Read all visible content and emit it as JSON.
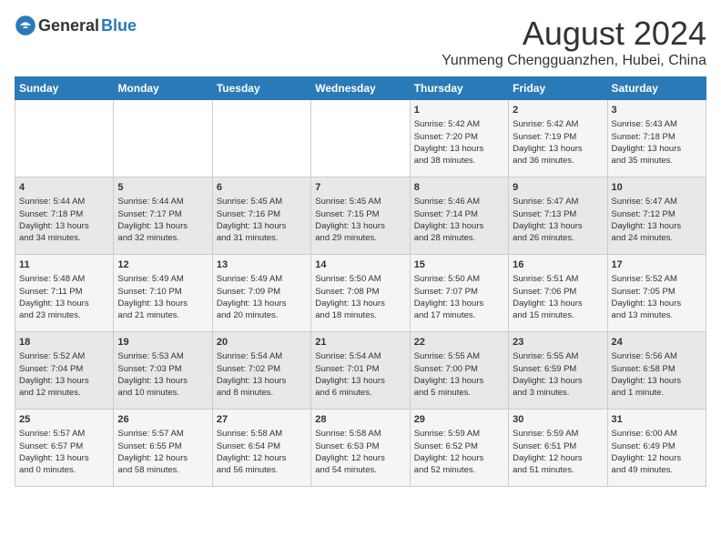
{
  "logo": {
    "general": "General",
    "blue": "Blue"
  },
  "title": "August 2024",
  "location": "Yunmeng Chengguanzhen, Hubei, China",
  "days_of_week": [
    "Sunday",
    "Monday",
    "Tuesday",
    "Wednesday",
    "Thursday",
    "Friday",
    "Saturday"
  ],
  "weeks": [
    [
      {
        "day": "",
        "data": ""
      },
      {
        "day": "",
        "data": ""
      },
      {
        "day": "",
        "data": ""
      },
      {
        "day": "",
        "data": ""
      },
      {
        "day": "1",
        "data": "Sunrise: 5:42 AM\nSunset: 7:20 PM\nDaylight: 13 hours\nand 38 minutes."
      },
      {
        "day": "2",
        "data": "Sunrise: 5:42 AM\nSunset: 7:19 PM\nDaylight: 13 hours\nand 36 minutes."
      },
      {
        "day": "3",
        "data": "Sunrise: 5:43 AM\nSunset: 7:18 PM\nDaylight: 13 hours\nand 35 minutes."
      }
    ],
    [
      {
        "day": "4",
        "data": "Sunrise: 5:44 AM\nSunset: 7:18 PM\nDaylight: 13 hours\nand 34 minutes."
      },
      {
        "day": "5",
        "data": "Sunrise: 5:44 AM\nSunset: 7:17 PM\nDaylight: 13 hours\nand 32 minutes."
      },
      {
        "day": "6",
        "data": "Sunrise: 5:45 AM\nSunset: 7:16 PM\nDaylight: 13 hours\nand 31 minutes."
      },
      {
        "day": "7",
        "data": "Sunrise: 5:45 AM\nSunset: 7:15 PM\nDaylight: 13 hours\nand 29 minutes."
      },
      {
        "day": "8",
        "data": "Sunrise: 5:46 AM\nSunset: 7:14 PM\nDaylight: 13 hours\nand 28 minutes."
      },
      {
        "day": "9",
        "data": "Sunrise: 5:47 AM\nSunset: 7:13 PM\nDaylight: 13 hours\nand 26 minutes."
      },
      {
        "day": "10",
        "data": "Sunrise: 5:47 AM\nSunset: 7:12 PM\nDaylight: 13 hours\nand 24 minutes."
      }
    ],
    [
      {
        "day": "11",
        "data": "Sunrise: 5:48 AM\nSunset: 7:11 PM\nDaylight: 13 hours\nand 23 minutes."
      },
      {
        "day": "12",
        "data": "Sunrise: 5:49 AM\nSunset: 7:10 PM\nDaylight: 13 hours\nand 21 minutes."
      },
      {
        "day": "13",
        "data": "Sunrise: 5:49 AM\nSunset: 7:09 PM\nDaylight: 13 hours\nand 20 minutes."
      },
      {
        "day": "14",
        "data": "Sunrise: 5:50 AM\nSunset: 7:08 PM\nDaylight: 13 hours\nand 18 minutes."
      },
      {
        "day": "15",
        "data": "Sunrise: 5:50 AM\nSunset: 7:07 PM\nDaylight: 13 hours\nand 17 minutes."
      },
      {
        "day": "16",
        "data": "Sunrise: 5:51 AM\nSunset: 7:06 PM\nDaylight: 13 hours\nand 15 minutes."
      },
      {
        "day": "17",
        "data": "Sunrise: 5:52 AM\nSunset: 7:05 PM\nDaylight: 13 hours\nand 13 minutes."
      }
    ],
    [
      {
        "day": "18",
        "data": "Sunrise: 5:52 AM\nSunset: 7:04 PM\nDaylight: 13 hours\nand 12 minutes."
      },
      {
        "day": "19",
        "data": "Sunrise: 5:53 AM\nSunset: 7:03 PM\nDaylight: 13 hours\nand 10 minutes."
      },
      {
        "day": "20",
        "data": "Sunrise: 5:54 AM\nSunset: 7:02 PM\nDaylight: 13 hours\nand 8 minutes."
      },
      {
        "day": "21",
        "data": "Sunrise: 5:54 AM\nSunset: 7:01 PM\nDaylight: 13 hours\nand 6 minutes."
      },
      {
        "day": "22",
        "data": "Sunrise: 5:55 AM\nSunset: 7:00 PM\nDaylight: 13 hours\nand 5 minutes."
      },
      {
        "day": "23",
        "data": "Sunrise: 5:55 AM\nSunset: 6:59 PM\nDaylight: 13 hours\nand 3 minutes."
      },
      {
        "day": "24",
        "data": "Sunrise: 5:56 AM\nSunset: 6:58 PM\nDaylight: 13 hours\nand 1 minute."
      }
    ],
    [
      {
        "day": "25",
        "data": "Sunrise: 5:57 AM\nSunset: 6:57 PM\nDaylight: 13 hours\nand 0 minutes."
      },
      {
        "day": "26",
        "data": "Sunrise: 5:57 AM\nSunset: 6:55 PM\nDaylight: 12 hours\nand 58 minutes."
      },
      {
        "day": "27",
        "data": "Sunrise: 5:58 AM\nSunset: 6:54 PM\nDaylight: 12 hours\nand 56 minutes."
      },
      {
        "day": "28",
        "data": "Sunrise: 5:58 AM\nSunset: 6:53 PM\nDaylight: 12 hours\nand 54 minutes."
      },
      {
        "day": "29",
        "data": "Sunrise: 5:59 AM\nSunset: 6:52 PM\nDaylight: 12 hours\nand 52 minutes."
      },
      {
        "day": "30",
        "data": "Sunrise: 5:59 AM\nSunset: 6:51 PM\nDaylight: 12 hours\nand 51 minutes."
      },
      {
        "day": "31",
        "data": "Sunrise: 6:00 AM\nSunset: 6:49 PM\nDaylight: 12 hours\nand 49 minutes."
      }
    ]
  ]
}
